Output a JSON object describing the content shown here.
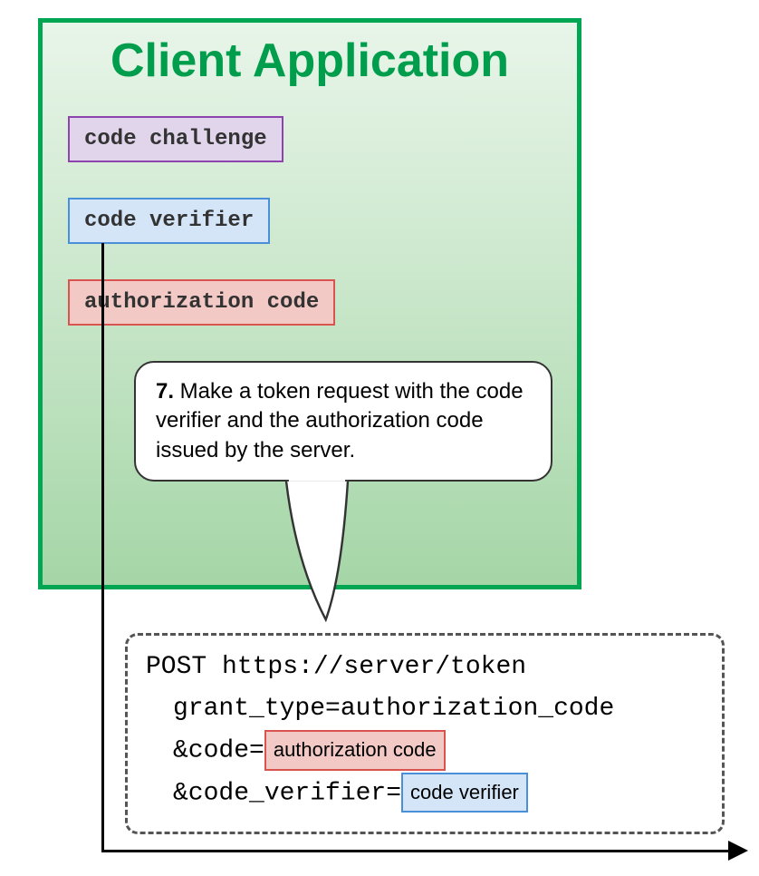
{
  "client": {
    "title": "Client Application",
    "challenge": "code challenge",
    "verifier": "code verifier",
    "auth_code": "authorization code"
  },
  "step": {
    "number": "7.",
    "text": " Make a token request with the code verifier and the authorization code issued by the server."
  },
  "request": {
    "line1": "POST https://server/token",
    "grant_type": "grant_type=authorization_code",
    "code_prefix": "&code=",
    "code_chip": "authorization code",
    "verifier_prefix": "&code_verifier=",
    "verifier_chip": "code verifier"
  }
}
